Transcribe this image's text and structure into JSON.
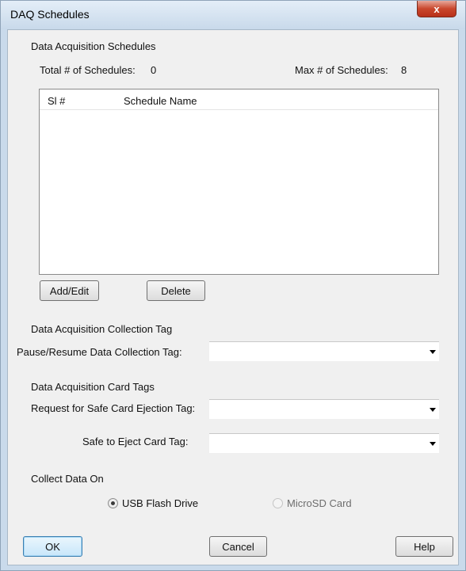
{
  "window": {
    "title": "DAQ Schedules",
    "close_glyph": "x"
  },
  "schedules": {
    "group_label": "Data Acquisition Schedules",
    "total_label": "Total # of Schedules:",
    "total_value": "0",
    "max_label": "Max # of Schedules:",
    "max_value": "8",
    "columns": [
      "Sl #",
      "Schedule Name"
    ],
    "rows": []
  },
  "buttons": {
    "add_edit": "Add/Edit",
    "delete": "Delete",
    "ok": "OK",
    "cancel": "Cancel",
    "help": "Help"
  },
  "collection_tag": {
    "group_label": "Data Acquisition Collection Tag",
    "pause_resume_label": "Pause/Resume Data Collection Tag:",
    "pause_resume_value": ""
  },
  "card_tags": {
    "group_label": "Data Acquisition Card Tags",
    "safe_ejection_label": "Request for Safe Card Ejection Tag:",
    "safe_ejection_value": "",
    "safe_to_eject_label": "Safe to Eject Card Tag:",
    "safe_to_eject_value": ""
  },
  "collect_on": {
    "group_label": "Collect Data On",
    "options": [
      {
        "label": "USB Flash Drive",
        "selected": true,
        "enabled": true
      },
      {
        "label": "MicroSD Card",
        "selected": false,
        "enabled": false
      }
    ]
  },
  "icons": {
    "close": "close-icon",
    "dropdown": "chevron-down-icon",
    "radio": "radio-icon"
  },
  "colors": {
    "close_button": "#c9472d",
    "window_frame": "#c9daeb",
    "dialog_background": "#f0f0f0"
  }
}
